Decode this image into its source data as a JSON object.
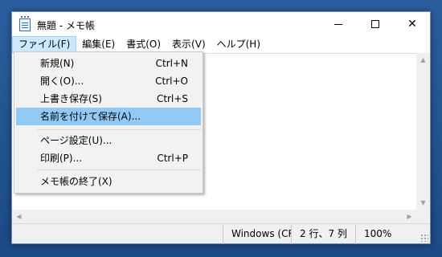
{
  "window": {
    "title": "無題 - メモ帳"
  },
  "title_buttons": {
    "minimize_icon": "minimize-icon",
    "maximize_icon": "maximize-icon",
    "close_glyph": "✕"
  },
  "menubar": {
    "items": [
      {
        "label": "ファイル(F)",
        "active": true
      },
      {
        "label": "編集(E)"
      },
      {
        "label": "書式(O)"
      },
      {
        "label": "表示(V)"
      },
      {
        "label": "ヘルプ(H)"
      }
    ]
  },
  "file_menu": {
    "items": [
      {
        "label": "新規(N)",
        "shortcut": "Ctrl+N"
      },
      {
        "label": "開く(O)...",
        "shortcut": "Ctrl+O"
      },
      {
        "label": "上書き保存(S)",
        "shortcut": "Ctrl+S"
      },
      {
        "label": "名前を付けて保存(A)...",
        "shortcut": "",
        "highlighted": true
      },
      {
        "label": "ページ設定(U)...",
        "shortcut": ""
      },
      {
        "label": "印刷(P)...",
        "shortcut": "Ctrl+P"
      },
      {
        "label": "メモ帳の終了(X)",
        "shortcut": ""
      }
    ],
    "highlight_color": "#91c9f7"
  },
  "editor": {
    "content": ""
  },
  "statusbar": {
    "encoding": "Windows (CRLF)",
    "position": "2 行、7 列",
    "zoom": "100%"
  },
  "colors": {
    "menu_active_bg": "#cce8ff",
    "desktop": "#1f4f8e"
  }
}
